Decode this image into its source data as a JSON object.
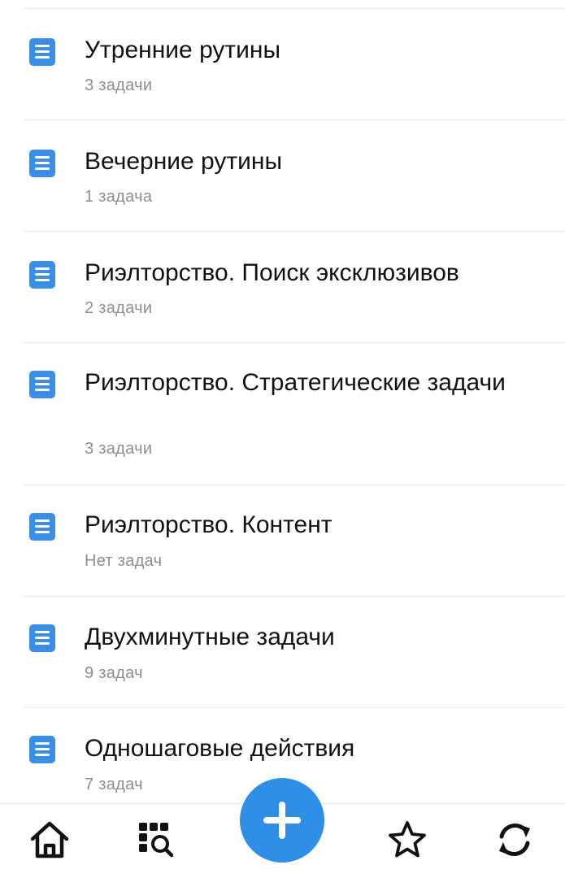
{
  "colors": {
    "accent": "#2f8ee6",
    "icon": "#3a8ee6",
    "title_text": "#111111",
    "subtitle_text": "#8e8e8e",
    "separator": "#ececec"
  },
  "lists": [
    {
      "title": "Утренние рутины",
      "subtitle": "3 задачи",
      "icon": "document-icon"
    },
    {
      "title": "Вечерние рутины",
      "subtitle": "1 задача",
      "icon": "document-icon"
    },
    {
      "title": "Риэлторство. Поиск эксклюзивов",
      "subtitle": "2 задачи",
      "icon": "document-icon"
    },
    {
      "title": "Риэлторство. Стратегические задачи",
      "subtitle": "3 задачи",
      "icon": "document-icon"
    },
    {
      "title": "Риэлторство. Контент",
      "subtitle": "Нет задач",
      "icon": "document-icon"
    },
    {
      "title": "Двухминутные задачи",
      "subtitle": "9 задач",
      "icon": "document-icon"
    },
    {
      "title": "Одношаговые действия",
      "subtitle": "7 задач",
      "icon": "document-icon"
    }
  ],
  "tabbar": {
    "tabs": [
      {
        "icon": "home-icon"
      },
      {
        "icon": "grid-search-icon"
      },
      {
        "icon": "plus-icon"
      },
      {
        "icon": "star-icon"
      },
      {
        "icon": "sync-icon"
      }
    ]
  }
}
